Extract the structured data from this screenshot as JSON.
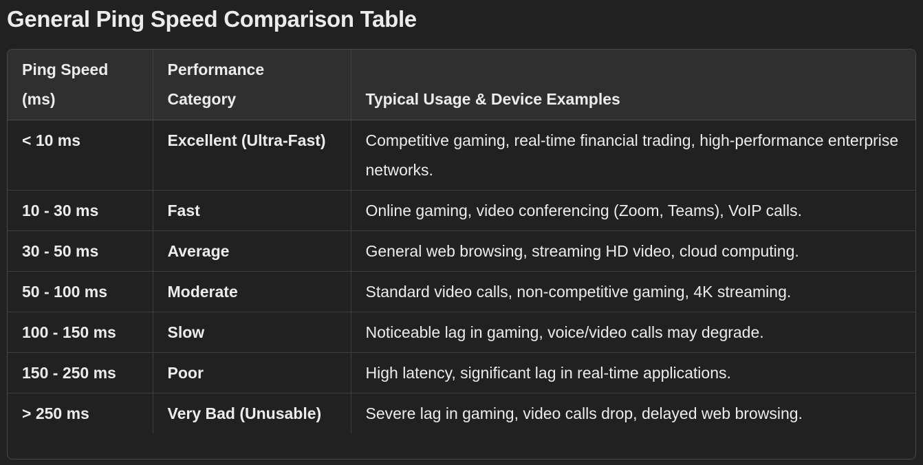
{
  "title": "General Ping Speed Comparison Table",
  "table": {
    "headers": [
      "Ping Speed (ms)",
      "Performance Category",
      "Typical Usage & Device Examples"
    ],
    "rows": [
      {
        "speed": "< 10 ms",
        "category": "Excellent (Ultra-Fast)",
        "usage": "Competitive gaming, real-time financial trading, high-performance enterprise networks."
      },
      {
        "speed": "10 - 30 ms",
        "category": "Fast",
        "usage": "Online gaming, video conferencing (Zoom, Teams), VoIP calls."
      },
      {
        "speed": "30 - 50 ms",
        "category": "Average",
        "usage": "General web browsing, streaming HD video, cloud computing."
      },
      {
        "speed": "50 - 100 ms",
        "category": "Moderate",
        "usage": "Standard video calls, non-competitive gaming, 4K streaming."
      },
      {
        "speed": "100 - 150 ms",
        "category": "Slow",
        "usage": "Noticeable lag in gaming, voice/video calls may degrade."
      },
      {
        "speed": "150 - 250 ms",
        "category": "Poor",
        "usage": "High latency, significant lag in real-time applications."
      },
      {
        "speed": "> 250 ms",
        "category": "Very Bad (Unusable)",
        "usage": "Severe lag in gaming, video calls drop, delayed web browsing."
      }
    ]
  }
}
